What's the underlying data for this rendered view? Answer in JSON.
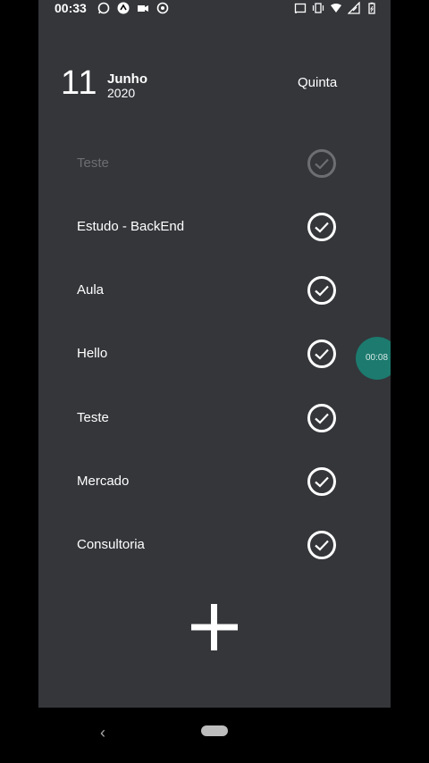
{
  "status_bar": {
    "time": "00:33",
    "left_icons": [
      "whatsapp-icon",
      "arrow-up-icon",
      "camera-icon",
      "sync-icon"
    ],
    "right_icons": [
      "cast-icon",
      "vibrate-icon",
      "wifi-icon",
      "signal-icon",
      "battery-icon"
    ]
  },
  "header": {
    "day": "11",
    "month": "Junho",
    "year": "2020",
    "weekday": "Quinta"
  },
  "tasks": [
    {
      "label": "Teste",
      "faded": true
    },
    {
      "label": "Estudo - BackEnd",
      "faded": false
    },
    {
      "label": "Aula",
      "faded": false
    },
    {
      "label": "Hello",
      "faded": false
    },
    {
      "label": "Teste",
      "faded": false
    },
    {
      "label": "Mercado",
      "faded": false
    },
    {
      "label": "Consultoria",
      "faded": false
    }
  ],
  "recording_bubble": {
    "time": "00:08"
  },
  "colors": {
    "background": "#34363a",
    "bubble": "#1c7a6e"
  }
}
